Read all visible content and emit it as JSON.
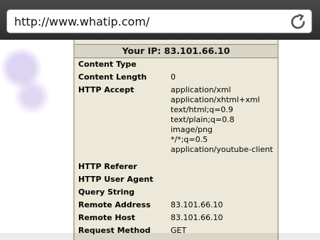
{
  "browser": {
    "url": "http://www.whatip.com/"
  },
  "page": {
    "ip_header": "Your IP: 83.101.66.10",
    "rows": [
      {
        "key": "Content Type",
        "value": ""
      },
      {
        "key": "Content Length",
        "value": "0"
      },
      {
        "key": "HTTP Accept",
        "value": "application/xml"
      },
      {
        "key": "",
        "value": "application/xhtml+xml"
      },
      {
        "key": "",
        "value": "text/html;q=0.9"
      },
      {
        "key": "",
        "value": "text/plain;q=0.8"
      },
      {
        "key": "",
        "value": "image/png"
      },
      {
        "key": "",
        "value": "*/*;q=0.5"
      },
      {
        "key": "",
        "value": "application/youtube-client"
      },
      {
        "key": "HTTP Referer",
        "value": ""
      },
      {
        "key": "HTTP User Agent",
        "value": ""
      },
      {
        "key": "Query String",
        "value": ""
      },
      {
        "key": "Remote Address",
        "value": "83.101.66.10"
      },
      {
        "key": "Remote Host",
        "value": "83.101.66.10"
      },
      {
        "key": "Request Method",
        "value": "GET"
      }
    ]
  }
}
